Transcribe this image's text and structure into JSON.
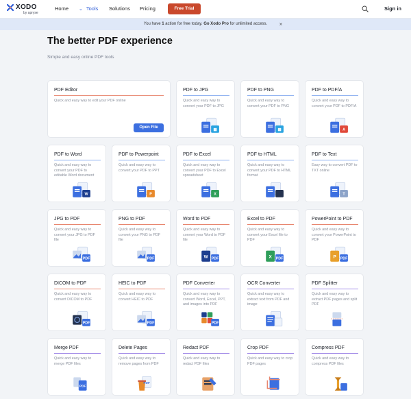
{
  "brand": {
    "name": "XODO",
    "byline": "by apryse"
  },
  "nav": {
    "home": "Home",
    "tools": "Tools",
    "solutions": "Solutions",
    "pricing": "Pricing",
    "trial": "Free Trial",
    "signin": "Sign in",
    "search_icon": "search-icon"
  },
  "banner": {
    "pre": "You have ",
    "count": "1",
    "mid": " action for free today. ",
    "pro": "Go Xodo Pro",
    "post": " for unlimited access.",
    "close": "×"
  },
  "hero": {
    "title": "The better PDF experience",
    "subtitle": "Simple and easy online PDF tools"
  },
  "editor": {
    "title": "PDF Editor",
    "desc": "Quick and easy way to edit your PDF online",
    "button": "Open File"
  },
  "colors": {
    "accent": "#3c6fe0",
    "trial": "#c9482c",
    "line_red": "#e8866f",
    "line_blue": "#8aaef0",
    "line_purple": "#a48de8"
  },
  "cards": [
    {
      "title": "PDF to JPG",
      "desc": "Quick and easy way to convert your PDF to JPG",
      "icon": "pdf-to-image-icon"
    },
    {
      "title": "PDF to PNG",
      "desc": "Quick and easy way to convert your PDF to PNG",
      "icon": "pdf-to-image-icon"
    },
    {
      "title": "PDF to PDF/A",
      "desc": "Quick and easy way to convert your PDF to PDF/A",
      "icon": "pdf-to-pdfa-icon"
    },
    {
      "title": "PDF to Word",
      "desc": "Quick and easy way to convert your PDF to editable Word document",
      "icon": "pdf-to-word-icon"
    },
    {
      "title": "PDF to Powerpoint",
      "desc": "Quick and easy way to convert your PDF to PPT",
      "icon": "pdf-to-ppt-icon"
    },
    {
      "title": "PDF to Excel",
      "desc": "Quick and easy way to convert your PDF to Excel spreadsheet",
      "icon": "pdf-to-excel-icon"
    },
    {
      "title": "PDF to HTML",
      "desc": "Quick and easy way to convert your PDF to HTML format",
      "icon": "pdf-to-html-icon"
    },
    {
      "title": "PDF to Text",
      "desc": "Easy way to convert PDF to TXT online",
      "icon": "pdf-to-text-icon"
    },
    {
      "title": "JPG to PDF",
      "desc": "Quick and easy way to convert your JPG to PDF file",
      "icon": "image-to-pdf-icon"
    },
    {
      "title": "PNG to PDF",
      "desc": "Quick and easy way to convert your PNG to PDF file",
      "icon": "image-to-pdf-icon"
    },
    {
      "title": "Word to PDF",
      "desc": "Quick and easy way to convert your Word to PDF file",
      "icon": "word-to-pdf-icon"
    },
    {
      "title": "Excel to PDF",
      "desc": "Quick and easy way to convert your Excel file to PDF",
      "icon": "excel-to-pdf-icon"
    },
    {
      "title": "PowerPoint to PDF",
      "desc": "Quick and easy way to convert your PowerPoint to PDF",
      "icon": "ppt-to-pdf-icon"
    },
    {
      "title": "DICOM to PDF",
      "desc": "Quick and easy way to convert DICOM to PDF",
      "icon": "dicom-to-pdf-icon"
    },
    {
      "title": "HEIC to PDF",
      "desc": "Quick and easy way to convert HEIC to PDF",
      "icon": "image-to-pdf-icon"
    },
    {
      "title": "PDF Converter",
      "desc": "Quick and easy way to convert Word, Excel, PPT, and images into PDF",
      "icon": "pdf-converter-icon"
    },
    {
      "title": "OCR Converter",
      "desc": "Quick and easy way to extract text from PDF and image",
      "icon": "ocr-icon"
    },
    {
      "title": "PDF Splitter",
      "desc": "Quick and easy way to extract PDF pages and split PDF",
      "icon": "split-pdf-icon"
    },
    {
      "title": "Merge PDF",
      "desc": "Quick and easy way to merge PDF files",
      "icon": "merge-pdf-icon"
    },
    {
      "title": "Delete Pages",
      "desc": "Quick and easy way to remove pages from PDF",
      "icon": "delete-pages-icon"
    },
    {
      "title": "Redact PDF",
      "desc": "Quick and easy way to redact PDF files",
      "icon": "redact-pdf-icon"
    },
    {
      "title": "Crop PDF",
      "desc": "Quick and easy way to crop PDF pages",
      "icon": "crop-pdf-icon"
    },
    {
      "title": "Compress PDF",
      "desc": "Quick and easy way to compress PDF files",
      "icon": "compress-pdf-icon"
    }
  ]
}
